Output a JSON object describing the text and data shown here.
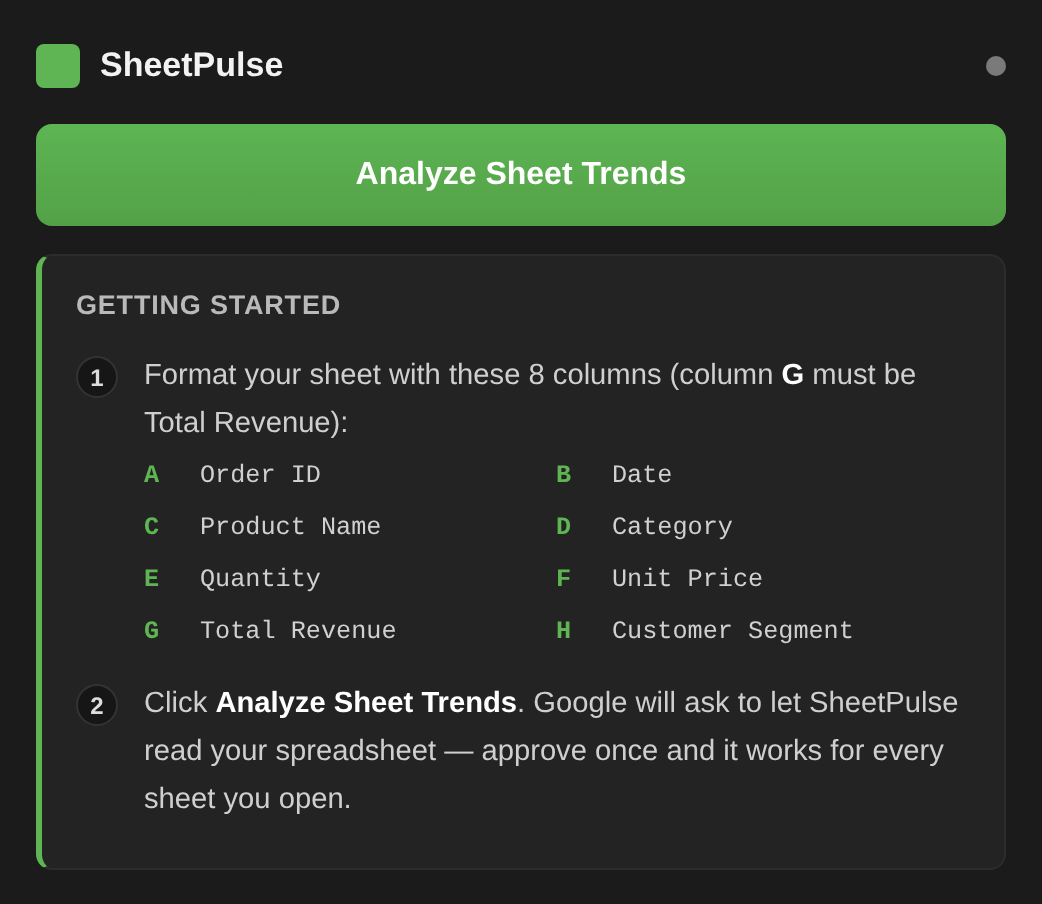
{
  "header": {
    "title": "SheetPulse"
  },
  "primary_button": {
    "label": "Analyze Sheet Trends"
  },
  "card": {
    "heading": "GETTING STARTED",
    "steps": [
      {
        "number": "1",
        "text": "Format your sheet with these 8 columns (column **G** must be Total Revenue):",
        "columns": [
          {
            "letter": "A",
            "name": "Order ID"
          },
          {
            "letter": "B",
            "name": "Date"
          },
          {
            "letter": "C",
            "name": "Product Name"
          },
          {
            "letter": "D",
            "name": "Category"
          },
          {
            "letter": "E",
            "name": "Quantity"
          },
          {
            "letter": "F",
            "name": "Unit Price"
          },
          {
            "letter": "G",
            "name": "Total Revenue"
          },
          {
            "letter": "H",
            "name": "Customer Segment"
          }
        ]
      },
      {
        "number": "2",
        "text": "Click **Analyze Sheet Trends**. Google will ask to let SheetPulse read your spreadsheet — approve once and it works for every sheet you open."
      }
    ]
  }
}
